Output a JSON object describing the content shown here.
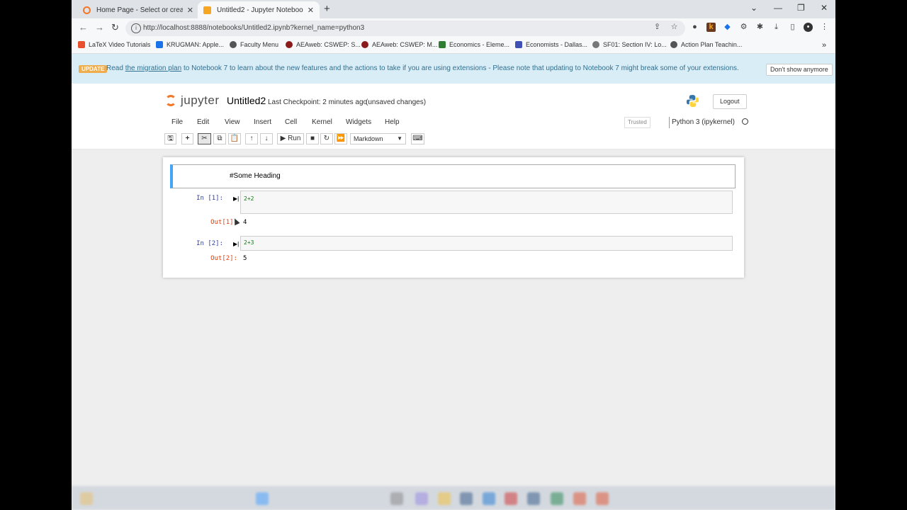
{
  "browser": {
    "tabs": [
      {
        "title": "Home Page - Select or create a",
        "active": false
      },
      {
        "title": "Untitled2 - Jupyter Notebook",
        "active": true
      }
    ],
    "url": "http://localhost:8888/notebooks/Untitled2.ipynb?kernel_name=python3",
    "bookmarks": [
      {
        "label": "LaTeX Video Tutorials",
        "color": "#e8502e"
      },
      {
        "label": "KRUGMAN: Apple...",
        "color": "#1a73e8"
      },
      {
        "label": "Faculty Menu",
        "color": "#555555"
      },
      {
        "label": "AEAweb: CSWEP: S...",
        "color": "#8b1a1a"
      },
      {
        "label": "AEAweb: CSWEP: M...",
        "color": "#8b1a1a"
      },
      {
        "label": "Economics - Eleme...",
        "color": "#2e7d32"
      },
      {
        "label": "Economists - Dallas...",
        "color": "#3f51b5"
      },
      {
        "label": "SF01: Section IV: Lo...",
        "color": "#777777"
      },
      {
        "label": "Action Plan Teachin...",
        "color": "#555555"
      }
    ]
  },
  "banner": {
    "badge": "UPDATE",
    "read": "Read",
    "link": "the migration plan",
    "rest": "to Notebook 7 to learn about the new features and the actions to take if you are using extensions - Please note that updating to Notebook 7 might break some of your extensions.",
    "dismiss": "Don't show anymore"
  },
  "header": {
    "logo_text": "jupyter",
    "notebook_name": "Untitled2",
    "checkpoint": "Last Checkpoint: 2 minutes ago",
    "unsaved": "(unsaved changes)",
    "logout": "Logout"
  },
  "menu": {
    "items": [
      "File",
      "Edit",
      "View",
      "Insert",
      "Cell",
      "Kernel",
      "Widgets",
      "Help"
    ],
    "trusted": "Trusted",
    "kernel": "Python 3 (ipykernel)"
  },
  "toolbar": {
    "run_label": "Run",
    "cell_type": "Markdown"
  },
  "cells": {
    "markdown": "#Some Heading",
    "code1": {
      "prompt_in": "In [1]:",
      "source": "2+2",
      "prompt_out": "Out[1]:",
      "output": "4"
    },
    "code2": {
      "prompt_in": "In [2]:",
      "source": "2+3",
      "prompt_out": "Out[2]:",
      "output": "5"
    }
  },
  "colors": {
    "accent_orange": "#f37726",
    "banner_bg": "#d9edf7",
    "selected_cell": "#42a5f5",
    "prompt_in": "#303f9f",
    "prompt_out": "#d84315"
  }
}
